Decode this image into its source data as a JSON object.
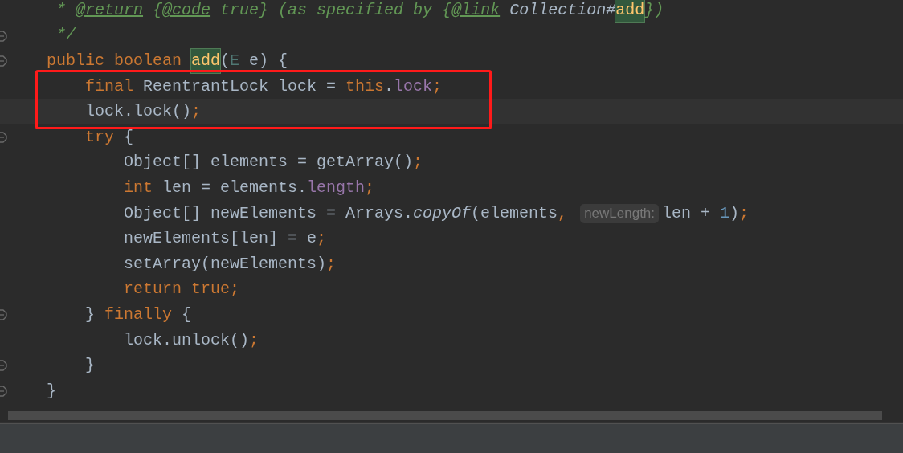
{
  "editor": {
    "lines": [
      {
        "kind": "doc",
        "tokens": [
          {
            "kind": "comment",
            "text": "* "
          },
          {
            "kind": "doc-tag",
            "text": "@return"
          },
          {
            "kind": "comment",
            "text": " {"
          },
          {
            "kind": "doc-tag",
            "text": "@code"
          },
          {
            "kind": "comment",
            "text": " true} (as specified by {"
          },
          {
            "kind": "doc-tag",
            "text": "@link"
          },
          {
            "kind": "doc-ref",
            "text": " Collection#"
          },
          {
            "kind": "match",
            "text": "add"
          },
          {
            "kind": "comment",
            "text": "})"
          }
        ]
      },
      {
        "kind": "doc",
        "tokens": [
          {
            "kind": "comment",
            "text": "*/"
          }
        ],
        "fold": true
      },
      {
        "kind": "code",
        "fold": true,
        "tokens": [
          {
            "kind": "keyword",
            "text": "public boolean "
          },
          {
            "kind": "match",
            "text": "add"
          },
          {
            "kind": "plain",
            "text": "("
          },
          {
            "kind": "type-param",
            "text": "E"
          },
          {
            "kind": "plain",
            "text": " e) {"
          }
        ],
        "children": [
          {
            "kind": "code",
            "boxed": true,
            "tokens": [
              {
                "kind": "keyword",
                "text": "final "
              },
              {
                "kind": "plain",
                "text": "ReentrantLock lock = "
              },
              {
                "kind": "keyword",
                "text": "this"
              },
              {
                "kind": "plain",
                "text": "."
              },
              {
                "kind": "field",
                "text": "lock"
              },
              {
                "kind": "keyword",
                "text": ";"
              }
            ]
          },
          {
            "kind": "code",
            "boxed": true,
            "current": true,
            "tokens": [
              {
                "kind": "plain",
                "text": "lock.lock()"
              },
              {
                "kind": "keyword",
                "text": ";"
              }
            ]
          },
          {
            "kind": "code",
            "fold": true,
            "tokens": [
              {
                "kind": "keyword",
                "text": "try "
              },
              {
                "kind": "plain",
                "text": "{"
              }
            ],
            "children": [
              {
                "kind": "code",
                "tokens": [
                  {
                    "kind": "plain",
                    "text": "Object[] elements = getArray()"
                  },
                  {
                    "kind": "keyword",
                    "text": ";"
                  }
                ]
              },
              {
                "kind": "code",
                "tokens": [
                  {
                    "kind": "keyword",
                    "text": "int "
                  },
                  {
                    "kind": "plain",
                    "text": "len = elements."
                  },
                  {
                    "kind": "field",
                    "text": "length"
                  },
                  {
                    "kind": "keyword",
                    "text": ";"
                  }
                ]
              },
              {
                "kind": "code",
                "tokens": [
                  {
                    "kind": "plain",
                    "text": "Object[] newElements = Arrays."
                  },
                  {
                    "kind": "static-call",
                    "text": "copyOf"
                  },
                  {
                    "kind": "plain",
                    "text": "(elements"
                  },
                  {
                    "kind": "keyword",
                    "text": ", "
                  },
                  {
                    "kind": "hint",
                    "text": "newLength:"
                  },
                  {
                    "kind": "plain",
                    "text": "len + "
                  },
                  {
                    "kind": "number",
                    "text": "1"
                  },
                  {
                    "kind": "plain",
                    "text": ")"
                  },
                  {
                    "kind": "keyword",
                    "text": ";"
                  }
                ]
              },
              {
                "kind": "code",
                "tokens": [
                  {
                    "kind": "plain",
                    "text": "newElements[len] = e"
                  },
                  {
                    "kind": "keyword",
                    "text": ";"
                  }
                ]
              },
              {
                "kind": "code",
                "tokens": [
                  {
                    "kind": "plain",
                    "text": "setArray(newElements)"
                  },
                  {
                    "kind": "keyword",
                    "text": ";"
                  }
                ]
              },
              {
                "kind": "code",
                "tokens": [
                  {
                    "kind": "keyword",
                    "text": "return true;"
                  }
                ]
              }
            ]
          },
          {
            "kind": "code",
            "fold": true,
            "tokens": [
              {
                "kind": "plain",
                "text": "} "
              },
              {
                "kind": "keyword",
                "text": "finally "
              },
              {
                "kind": "plain",
                "text": "{"
              }
            ],
            "children": [
              {
                "kind": "code",
                "tokens": [
                  {
                    "kind": "plain",
                    "text": "lock.unlock()"
                  },
                  {
                    "kind": "keyword",
                    "text": ";"
                  }
                ]
              }
            ]
          },
          {
            "kind": "code",
            "fold": true,
            "tokens": [
              {
                "kind": "plain",
                "text": "}"
              }
            ]
          }
        ]
      },
      {
        "kind": "code",
        "fold": true,
        "tokens": [
          {
            "kind": "plain",
            "text": "}"
          }
        ]
      }
    ]
  }
}
